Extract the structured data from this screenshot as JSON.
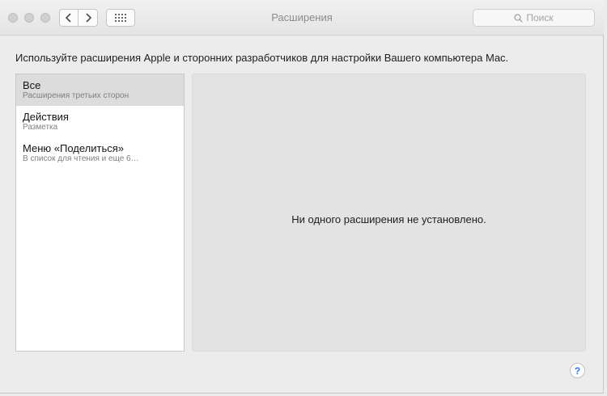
{
  "window": {
    "title": "Расширения",
    "search_placeholder": "Поиск"
  },
  "description": "Используйте расширения Apple и сторонних разработчиков для настройки Вашего компьютера Mac.",
  "list": {
    "items": [
      {
        "title": "Все",
        "subtitle": "Расширения третьих сторон",
        "selected": true
      },
      {
        "title": "Действия",
        "subtitle": "Разметка",
        "selected": false
      },
      {
        "title": "Меню «Поделиться»",
        "subtitle": "В список для чтения и еще 6…",
        "selected": false
      }
    ]
  },
  "detail": {
    "empty_message": "Ни одного расширения не установлено."
  },
  "help_label": "?",
  "icons": {
    "back": "chevron-left-icon",
    "forward": "chevron-right-icon",
    "grid": "grid-icon",
    "search": "search-icon"
  }
}
